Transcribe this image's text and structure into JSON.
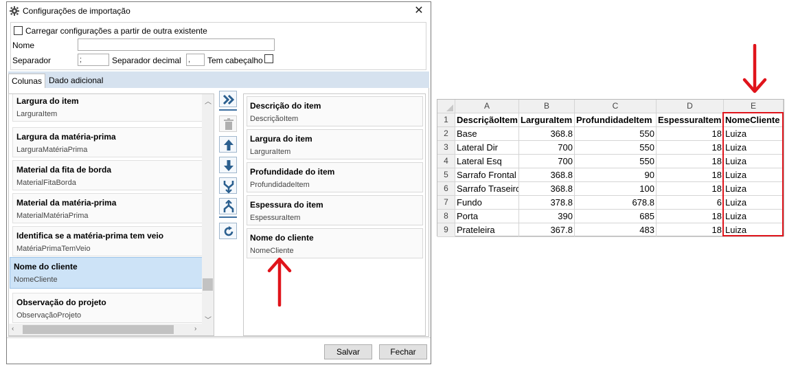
{
  "dialog": {
    "title": "Configurações de importação",
    "load_existing_label": "Carregar configurações a partir de outra existente",
    "name_label": "Nome",
    "name_value": "",
    "separator_label": "Separador",
    "separator_value": ";",
    "decimal_separator_label": "Separador decimal",
    "decimal_separator_value": ",",
    "has_header_label": "Tem cabeçalho",
    "tabs": [
      {
        "label": "Colunas",
        "active": true
      },
      {
        "label": "Dado adicional",
        "active": false
      }
    ],
    "available_columns": [
      {
        "title": "Largura do item",
        "field": "LarguraItem"
      },
      {
        "title": "Largura da matéria-prima",
        "field": "LarguraMatériaPrima"
      },
      {
        "title": "Material da fita de borda",
        "field": "MaterialFitaBorda"
      },
      {
        "title": "Material da matéria-prima",
        "field": "MaterialMatériaPrima"
      },
      {
        "title": "Identifica se a matéria-prima tem veio",
        "field": "MatériaPrimaTemVeio"
      },
      {
        "title": "Nome do cliente",
        "field": "NomeCliente",
        "selected": true
      },
      {
        "title": "Observação do projeto",
        "field": "ObservaçãoProjeto"
      }
    ],
    "selected_columns": [
      {
        "title": "Descrição do item",
        "field": "DescriçãoItem"
      },
      {
        "title": "Largura do item",
        "field": "LarguraItem"
      },
      {
        "title": "Profundidade do item",
        "field": "ProfundidadeItem"
      },
      {
        "title": "Espessura do item",
        "field": "EspessuraItem"
      },
      {
        "title": "Nome do cliente",
        "field": "NomeCliente"
      }
    ],
    "save_label": "Salvar",
    "close_label": "Fechar"
  },
  "spreadsheet": {
    "columns": [
      "A",
      "B",
      "C",
      "D",
      "E"
    ],
    "rows": [
      {
        "n": "1",
        "a": "DescriçãoItem",
        "b": "LarguraItem",
        "c": "ProfundidadeItem",
        "d": "EspessuraItem",
        "e": "NomeCliente"
      },
      {
        "n": "2",
        "a": "Base",
        "b": "368.8",
        "c": "550",
        "d": "18",
        "e": "Luiza"
      },
      {
        "n": "3",
        "a": "Lateral Dir",
        "b": "700",
        "c": "550",
        "d": "18",
        "e": "Luiza"
      },
      {
        "n": "4",
        "a": "Lateral Esq",
        "b": "700",
        "c": "550",
        "d": "18",
        "e": "Luiza"
      },
      {
        "n": "5",
        "a": "Sarrafo Frontal",
        "b": "368.8",
        "c": "90",
        "d": "18",
        "e": "Luiza"
      },
      {
        "n": "6",
        "a": "Sarrafo Traseiro",
        "b": "368.8",
        "c": "100",
        "d": "18",
        "e": "Luiza"
      },
      {
        "n": "7",
        "a": "Fundo",
        "b": "378.8",
        "c": "678.8",
        "d": "6",
        "e": "Luiza"
      },
      {
        "n": "8",
        "a": "Porta",
        "b": "390",
        "c": "685",
        "d": "18",
        "e": "Luiza"
      },
      {
        "n": "9",
        "a": "Prateleira",
        "b": "367.8",
        "c": "483",
        "d": "18",
        "e": "Luiza"
      }
    ]
  },
  "colors": {
    "annotation": "#e0141b",
    "selection": "#cde3f7",
    "accent": "#3c6e9f"
  }
}
